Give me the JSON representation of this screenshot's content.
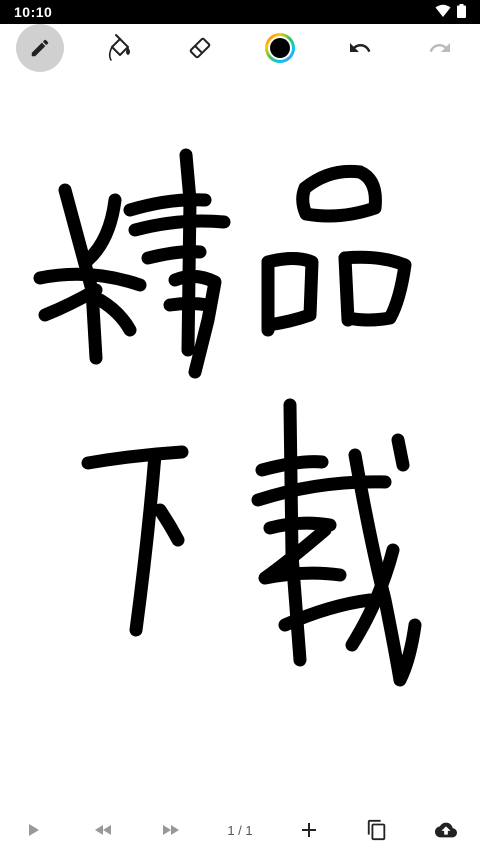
{
  "status_bar": {
    "time": "10:10",
    "icons": [
      "wifi-icon",
      "battery-icon"
    ]
  },
  "toolbar": {
    "tools": [
      {
        "name": "pen",
        "icon": "pencil-icon",
        "selected": true
      },
      {
        "name": "fill",
        "icon": "paint-bucket-icon",
        "selected": false
      },
      {
        "name": "eraser",
        "icon": "eraser-icon",
        "selected": false
      },
      {
        "name": "color",
        "icon": "color-wheel-icon",
        "selected": false,
        "current_color": "#000000"
      },
      {
        "name": "undo",
        "icon": "undo-icon",
        "selected": false,
        "enabled": true
      },
      {
        "name": "redo",
        "icon": "redo-icon",
        "selected": false,
        "enabled": false
      }
    ]
  },
  "canvas": {
    "stroke_color": "#000000",
    "background": "#ffffff"
  },
  "bottom_bar": {
    "page_indicator": "1 / 1",
    "buttons": [
      "play-icon",
      "rewind-icon",
      "fast-forward-icon",
      "add-icon",
      "copy-icon",
      "cloud-upload-icon"
    ]
  },
  "colors": {
    "selected_bg": "#d0d0d0",
    "icon_dark": "#222222",
    "icon_disabled": "#bbbbbb",
    "icon_muted": "#999999"
  }
}
